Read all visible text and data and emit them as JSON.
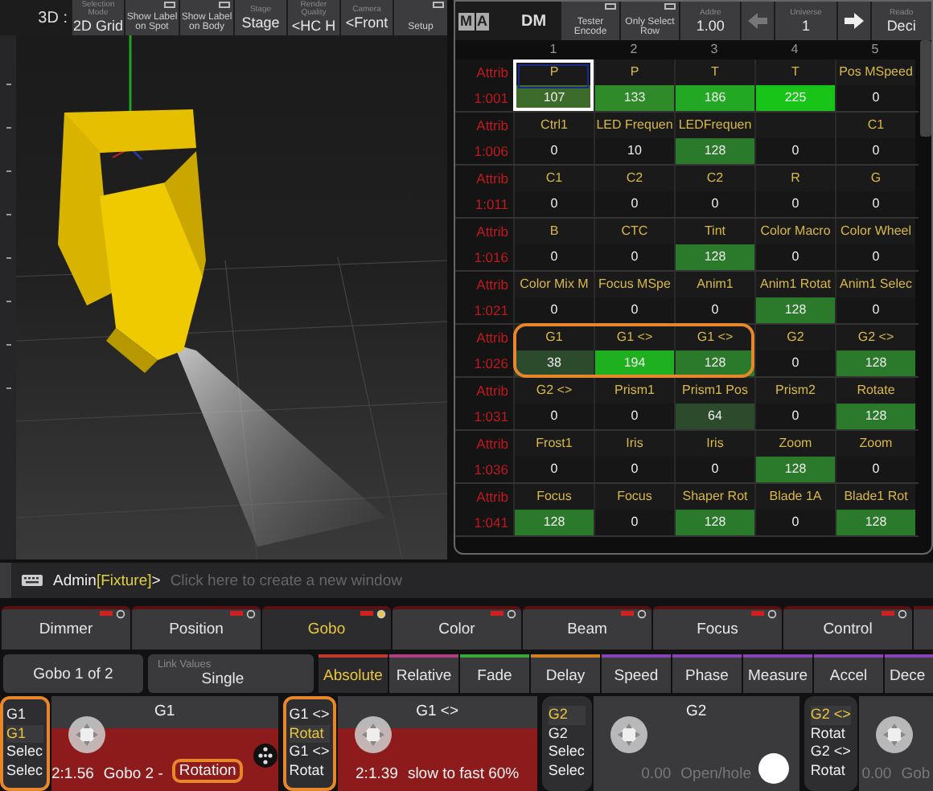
{
  "viewer": {
    "title": "3D :",
    "toolbar": [
      {
        "kind": "select",
        "caption": "Selection Mode",
        "value": "2D Grid"
      },
      {
        "kind": "toggle",
        "value": "Show Label on Spot",
        "on": false
      },
      {
        "kind": "toggle",
        "value": "Show Label on Body",
        "on": false
      },
      {
        "kind": "select",
        "caption": "Stage",
        "value": "Stage"
      },
      {
        "kind": "select",
        "caption": "Render Quality",
        "value": "<HC H"
      },
      {
        "kind": "select",
        "caption": "Camera",
        "value": "<Front"
      },
      {
        "kind": "toggle",
        "value": "Setup",
        "on": false
      }
    ]
  },
  "sheet": {
    "logo": [
      "M",
      "A"
    ],
    "mode": "DM",
    "toolbar": [
      {
        "kind": "toggle",
        "value": "Tester Encode",
        "on": false
      },
      {
        "kind": "toggle",
        "value": "Only Select Row",
        "on": false
      },
      {
        "kind": "select",
        "caption": "Addre",
        "value": "1.00"
      },
      {
        "kind": "arrow-left"
      },
      {
        "kind": "select",
        "caption": "Universe",
        "value": "1"
      },
      {
        "kind": "arrow-right"
      },
      {
        "kind": "select",
        "caption": "Reado",
        "value": "Deci"
      }
    ],
    "columns": [
      "1",
      "2",
      "3",
      "4",
      "5"
    ],
    "rows": [
      {
        "label": "Attrib",
        "id": "1:001",
        "cells": [
          {
            "name": "P",
            "value": "107",
            "color": "#3d6b2c",
            "selected": true,
            "marked": false
          },
          {
            "name": "P",
            "value": "133",
            "color": "#2f8a2a",
            "selected": false,
            "marked": false
          },
          {
            "name": "T",
            "value": "186",
            "color": "#23a823",
            "selected": false,
            "marked": false
          },
          {
            "name": "T",
            "value": "225",
            "color": "#18c418",
            "selected": false,
            "marked": false
          },
          {
            "name": "Pos MSpeed",
            "value": "0",
            "selected": false,
            "marked": false
          }
        ]
      },
      {
        "label": "Attrib",
        "id": "1:006",
        "cells": [
          {
            "name": "Ctrl1",
            "value": "0",
            "selected": false,
            "marked": false
          },
          {
            "name": "LED Frequen",
            "value": "10",
            "selected": false,
            "marked": false
          },
          {
            "name": "LEDFrequen",
            "value": "128",
            "color": "#2b7a2b",
            "selected": false,
            "marked": false
          },
          {
            "value": "0",
            "selected": false,
            "marked": false
          },
          {
            "name": "C1",
            "value": "0",
            "selected": false,
            "marked": false
          }
        ]
      },
      {
        "label": "Attrib",
        "id": "1:011",
        "cells": [
          {
            "name": "C1",
            "value": "0",
            "selected": false,
            "marked": false
          },
          {
            "name": "C2",
            "value": "0",
            "selected": false,
            "marked": false
          },
          {
            "name": "C2",
            "value": "0",
            "selected": false,
            "marked": false
          },
          {
            "name": "R",
            "value": "0",
            "selected": false,
            "marked": false
          },
          {
            "name": "G",
            "value": "0",
            "selected": false,
            "marked": false
          }
        ]
      },
      {
        "label": "Attrib",
        "id": "1:016",
        "cells": [
          {
            "name": "B",
            "value": "0",
            "selected": false,
            "marked": false
          },
          {
            "name": "CTC",
            "value": "0",
            "selected": false,
            "marked": false
          },
          {
            "name": "Tint",
            "value": "128",
            "color": "#2b7a2b",
            "selected": false,
            "marked": false
          },
          {
            "name": "Color Macro",
            "value": "0",
            "selected": false,
            "marked": false
          },
          {
            "name": "Color Wheel",
            "value": "0",
            "selected": false,
            "marked": false
          }
        ]
      },
      {
        "label": "Attrib",
        "id": "1:021",
        "cells": [
          {
            "name": "Color Mix M",
            "value": "0",
            "selected": false,
            "marked": false
          },
          {
            "name": "Focus MSpe",
            "value": "0",
            "selected": false,
            "marked": false
          },
          {
            "name": "Anim1",
            "value": "0",
            "selected": false,
            "marked": false
          },
          {
            "name": "Anim1 Rotat",
            "value": "128",
            "color": "#2b7a2b",
            "selected": false,
            "marked": false
          },
          {
            "name": "Anim1 Selec",
            "value": "0",
            "selected": false,
            "marked": false
          }
        ]
      },
      {
        "label": "Attrib",
        "id": "1:026",
        "cells": [
          {
            "name": "G1",
            "value": "38",
            "color": "#2c4a2c",
            "selected": false,
            "marked": true
          },
          {
            "name": "G1 <>",
            "value": "194",
            "color": "#1fb01f",
            "selected": false,
            "marked": true
          },
          {
            "name": "G1 <>",
            "value": "128",
            "color": "#2b7a2b",
            "selected": false,
            "marked": true
          },
          {
            "name": "G2",
            "value": "0",
            "selected": false,
            "marked": false
          },
          {
            "name": "G2 <>",
            "value": "128",
            "color": "#2b7a2b",
            "selected": false,
            "marked": false
          }
        ]
      },
      {
        "label": "Attrib",
        "id": "1:031",
        "cells": [
          {
            "name": "G2 <>",
            "value": "0",
            "selected": false,
            "marked": false
          },
          {
            "name": "Prism1",
            "value": "0",
            "selected": false,
            "marked": false
          },
          {
            "name": "Prism1 Pos",
            "value": "64",
            "color": "#2c4a2c",
            "selected": false,
            "marked": false
          },
          {
            "name": "Prism2",
            "value": "0",
            "selected": false,
            "marked": false
          },
          {
            "name": "Rotate",
            "value": "128",
            "color": "#2b7a2b",
            "selected": false,
            "marked": false
          }
        ]
      },
      {
        "label": "Attrib",
        "id": "1:036",
        "cells": [
          {
            "name": "Frost1",
            "value": "0",
            "selected": false,
            "marked": false
          },
          {
            "name": "Iris",
            "value": "0",
            "selected": false,
            "marked": false
          },
          {
            "name": "Iris",
            "value": "0",
            "selected": false,
            "marked": false
          },
          {
            "name": "Zoom",
            "value": "128",
            "color": "#2b7a2b",
            "selected": false,
            "marked": false
          },
          {
            "name": "Zoom",
            "value": "0",
            "selected": false,
            "marked": false
          }
        ]
      },
      {
        "label": "Attrib",
        "id": "1:041",
        "cells": [
          {
            "name": "Focus",
            "value": "128",
            "color": "#2b7a2b",
            "selected": false,
            "marked": false
          },
          {
            "name": "Focus",
            "value": "0",
            "selected": false,
            "marked": false
          },
          {
            "name": "Shaper Rot",
            "value": "128",
            "color": "#2b7a2b",
            "selected": false,
            "marked": false
          },
          {
            "name": "Blade 1A",
            "value": "0",
            "selected": false,
            "marked": false
          },
          {
            "name": "Blade1 Rot",
            "value": "128",
            "color": "#2b7a2b",
            "selected": false,
            "marked": false
          }
        ]
      }
    ]
  },
  "command_line": {
    "user": "Admin",
    "object": "[Fixture]",
    "suffix": ">",
    "placeholder": "Click here to create a new window"
  },
  "feature_tabs": [
    {
      "label": "Dimmer",
      "selected": false
    },
    {
      "label": "Position",
      "selected": false
    },
    {
      "label": "Gobo",
      "selected": true
    },
    {
      "label": "Color",
      "selected": false
    },
    {
      "label": "Beam",
      "selected": false
    },
    {
      "label": "Focus",
      "selected": false
    },
    {
      "label": "Control",
      "selected": false
    }
  ],
  "feature_page": "Gobo 1 of 2",
  "link_values": {
    "caption": "Link Values",
    "value": "Single"
  },
  "layers": [
    {
      "label": "Absolute",
      "selected": true,
      "color": "#c0392b"
    },
    {
      "label": "Relative",
      "selected": false,
      "color": "#b04080"
    },
    {
      "label": "Fade",
      "selected": false,
      "color": "#38a838"
    },
    {
      "label": "Delay",
      "selected": false,
      "color": "#d08020"
    },
    {
      "label": "Speed",
      "selected": false,
      "color": "#8844b4"
    },
    {
      "label": "Phase",
      "selected": false,
      "color": "#8844b4"
    },
    {
      "label": "Measure",
      "selected": false,
      "color": "#8844b4"
    },
    {
      "label": "Accel",
      "selected": false,
      "color": "#8844b4"
    },
    {
      "label": "Dece",
      "selected": false,
      "color": "#8844b4"
    }
  ],
  "encoders": [
    {
      "options": [
        {
          "label": "G1",
          "selected": false
        },
        {
          "label": "G1",
          "selected": true
        },
        {
          "label": "Selec",
          "selected": false
        },
        {
          "label": "Selec",
          "selected": false
        }
      ],
      "marked": true,
      "title": "G1",
      "active": true,
      "reading": "2:1.56",
      "words": [
        {
          "text": "Gobo 2 -",
          "marked": false
        },
        {
          "text": "Rotation",
          "marked": true
        }
      ],
      "kind": "gobo"
    },
    {
      "options": [
        {
          "label": "G1 <>",
          "selected": false
        },
        {
          "label": "Rotat",
          "selected": true
        },
        {
          "label": "G1 <>",
          "selected": false
        },
        {
          "label": "Rotat",
          "selected": false
        }
      ],
      "marked": true,
      "title": "G1 <>",
      "active": true,
      "reading": "2:1.39",
      "words": [
        {
          "text": "slow to fast 60%",
          "marked": false
        }
      ],
      "kind": "plain"
    },
    {
      "options": [
        {
          "label": "G2",
          "selected": true
        },
        {
          "label": "G2",
          "selected": false
        },
        {
          "label": "Selec",
          "selected": false
        },
        {
          "label": "Selec",
          "selected": false
        }
      ],
      "marked": false,
      "title": "G2",
      "active": false,
      "reading": "0.00",
      "words": [
        {
          "text": "Open/hole",
          "marked": false
        }
      ],
      "kind": "open"
    },
    {
      "options": [
        {
          "label": "G2 <>",
          "selected": true
        },
        {
          "label": "Rotat",
          "selected": false
        },
        {
          "label": "G2 <>",
          "selected": false
        },
        {
          "label": "Rotat",
          "selected": false
        }
      ],
      "marked": false,
      "active": false,
      "reading": "0.00",
      "words": [
        {
          "text": "Gob",
          "marked": false
        }
      ],
      "kind": "plain"
    }
  ]
}
